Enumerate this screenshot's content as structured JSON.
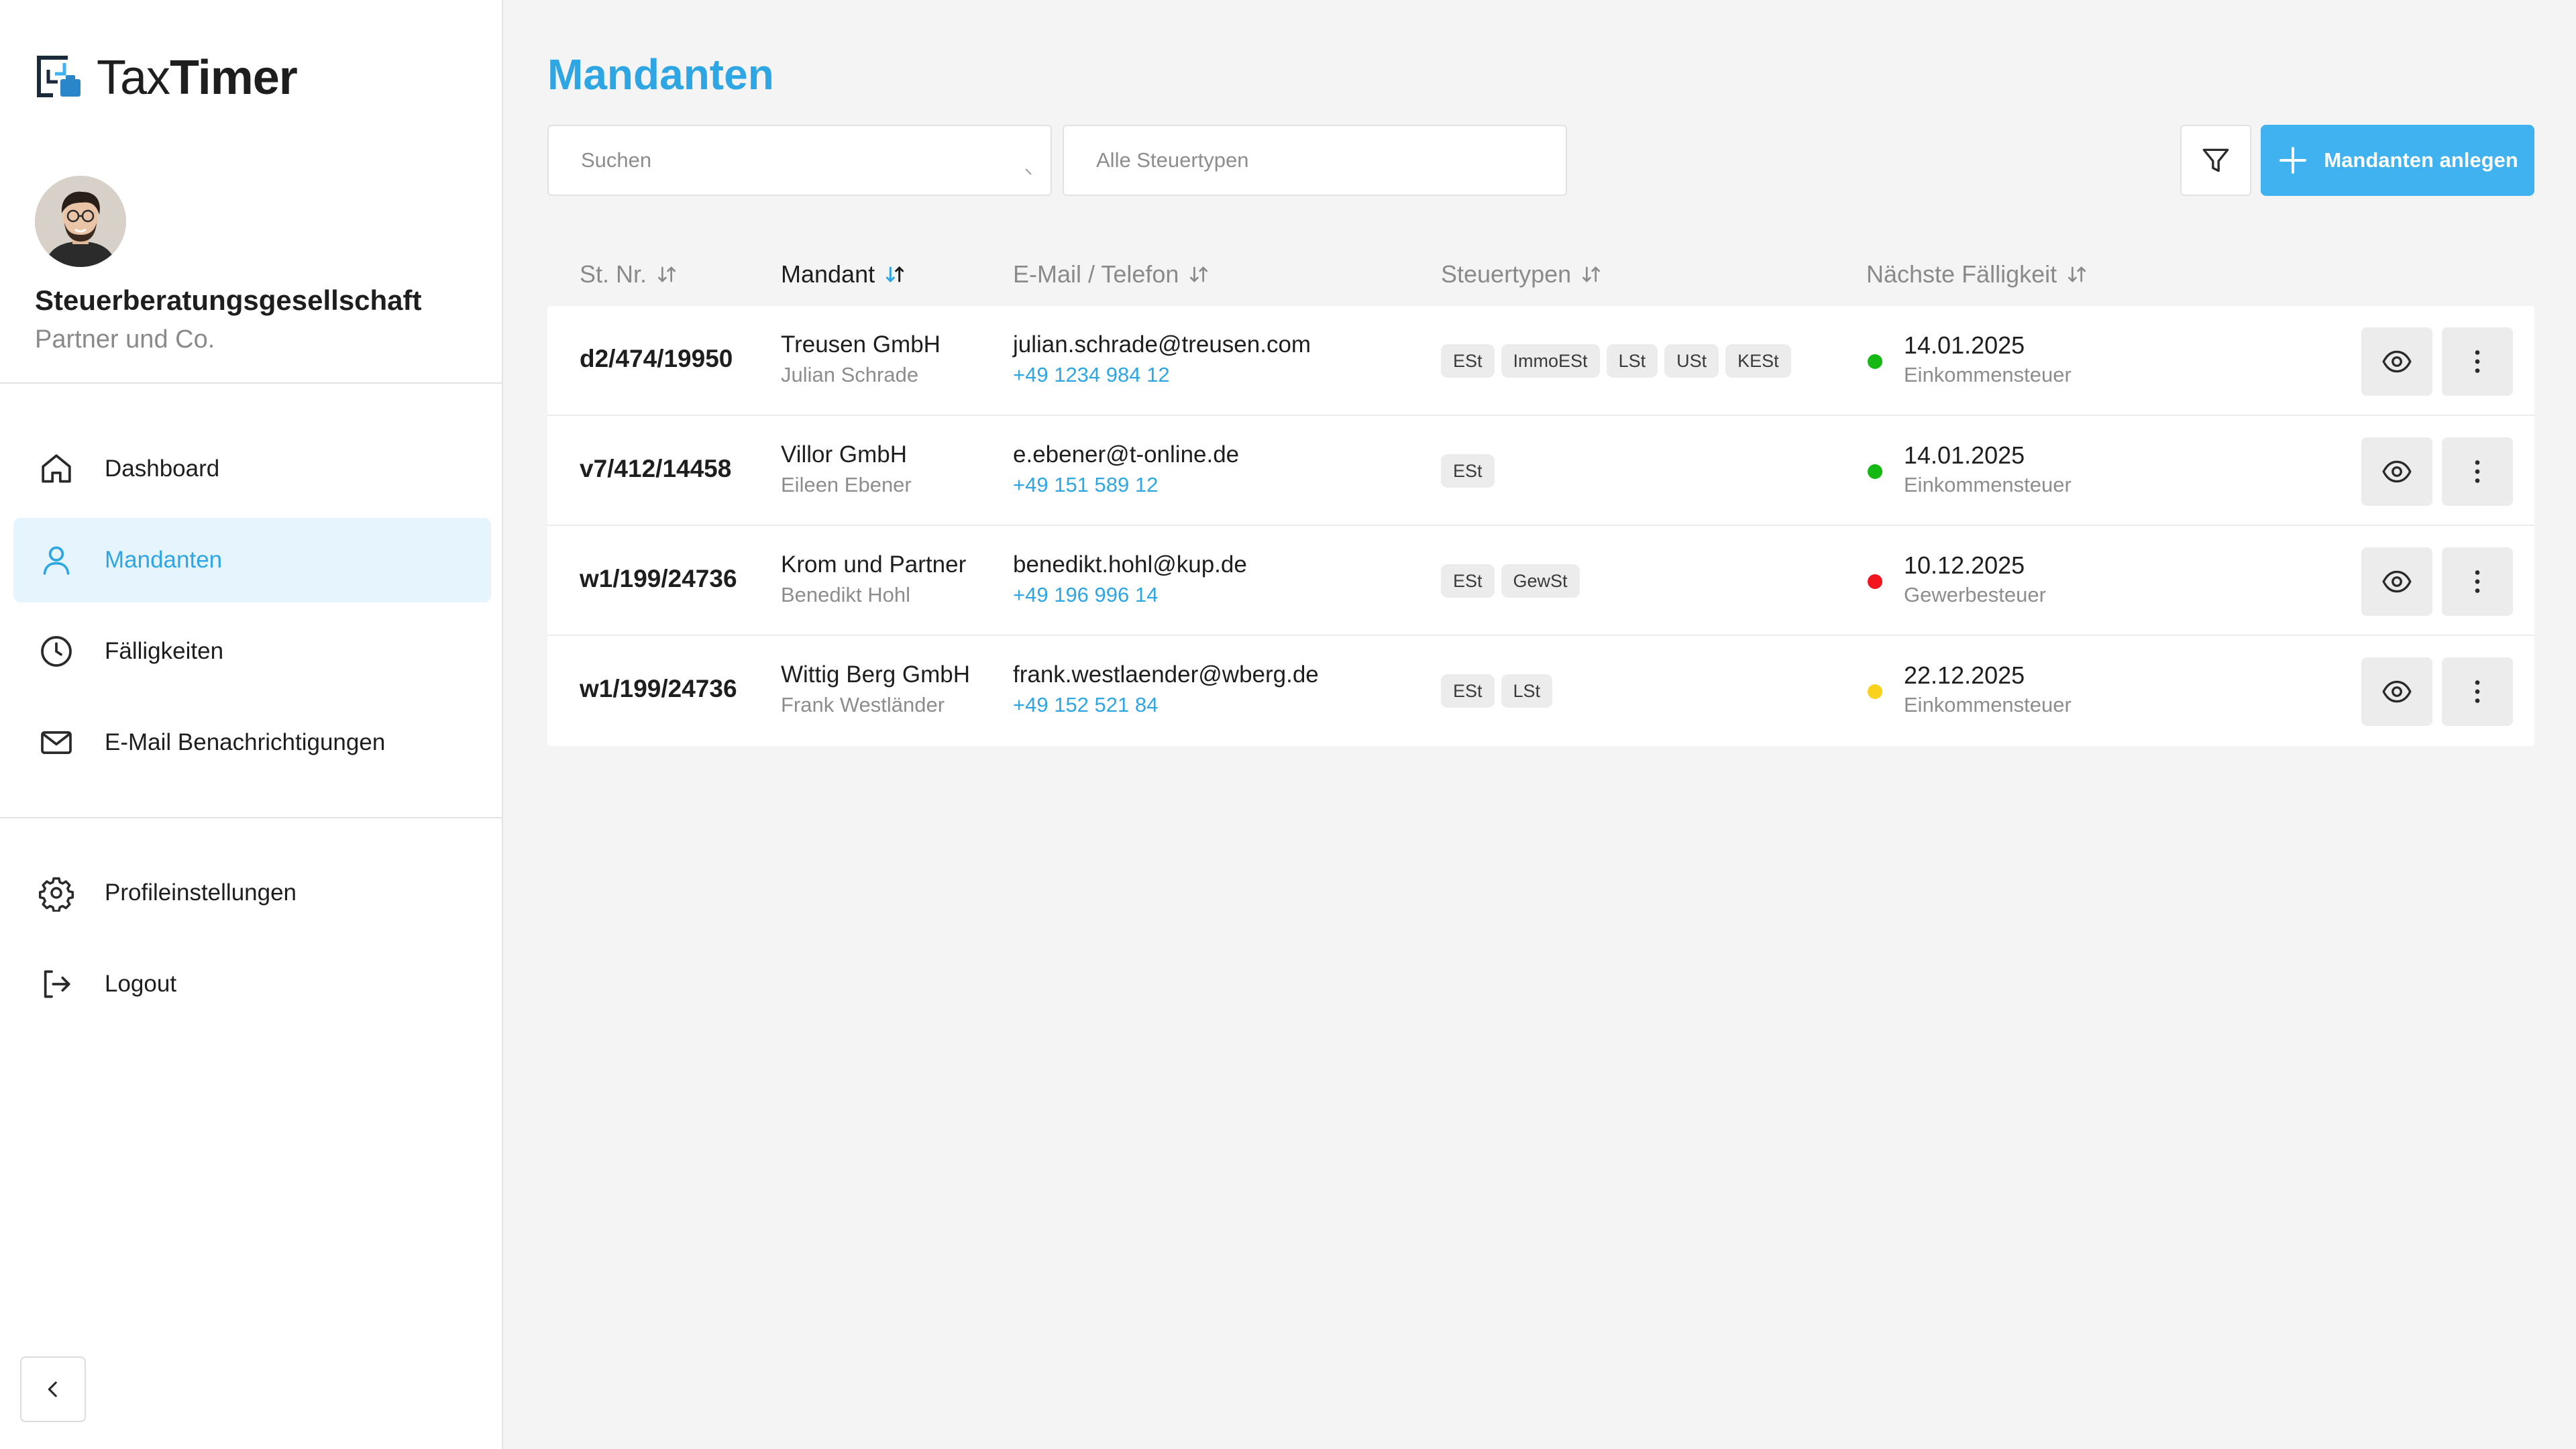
{
  "brand": {
    "logo_prefix": "Tax",
    "logo_suffix": "Timer"
  },
  "profile": {
    "org_name": "Steuerberatungsgesellschaft",
    "org_sub": "Partner und Co."
  },
  "nav": [
    {
      "label": "Dashboard",
      "icon": "home-icon",
      "active": false
    },
    {
      "label": "Mandanten",
      "icon": "user-icon",
      "active": true
    },
    {
      "label": "Fälligkeiten",
      "icon": "clock-icon",
      "active": false
    },
    {
      "label": "E-Mail Benachrichtigungen",
      "icon": "mail-icon",
      "active": false
    }
  ],
  "nav_bottom": [
    {
      "label": "Profileinstellungen",
      "icon": "gear-icon"
    },
    {
      "label": "Logout",
      "icon": "logout-icon"
    }
  ],
  "page": {
    "title": "Mandanten",
    "search_placeholder": "Suchen",
    "type_filter_placeholder": "Alle Steuertypen",
    "add_button": "Mandanten anlegen"
  },
  "table": {
    "columns": [
      "St. Nr.",
      "Mandant",
      "E-Mail / Telefon",
      "Steuertypen",
      "Nächste Fälligkeit"
    ],
    "sorted_column": "Mandant",
    "rows": [
      {
        "st_nr": "d2/474/19950",
        "name": "Treusen GmbH",
        "person": "Julian Schrade",
        "email": "julian.schrade@treusen.com",
        "phone": "+49 1234 984 12",
        "tags": [
          "ESt",
          "ImmoESt",
          "LSt",
          "USt",
          "KESt"
        ],
        "status": "green",
        "due_date": "14.01.2025",
        "due_type": "Einkommensteuer"
      },
      {
        "st_nr": "v7/412/14458",
        "name": "Villor GmbH",
        "person": "Eileen Ebener",
        "email": "e.ebener@t-online.de",
        "phone": "+49 151 589 12",
        "tags": [
          "ESt"
        ],
        "status": "green",
        "due_date": "14.01.2025",
        "due_type": "Einkommensteuer"
      },
      {
        "st_nr": "w1/199/24736",
        "name": "Krom und Partner",
        "person": "Benedikt Hohl",
        "email": "benedikt.hohl@kup.de",
        "phone": "+49 196 996 14",
        "tags": [
          "ESt",
          "GewSt"
        ],
        "status": "red",
        "due_date": "10.12.2025",
        "due_type": "Gewerbesteuer"
      },
      {
        "st_nr": "w1/199/24736",
        "name": "Wittig Berg GmbH",
        "person": "Frank Westländer",
        "email": "frank.westlaender@wberg.de",
        "phone": "+49 152 521 84",
        "tags": [
          "ESt",
          "LSt"
        ],
        "status": "yellow",
        "due_date": "22.12.2025",
        "due_type": "Einkommensteuer"
      }
    ]
  },
  "colors": {
    "accent": "#3fb2ef",
    "accent_text": "#2ea6e4",
    "active_nav_bg": "#e6f5fd",
    "status_green": "#16b814",
    "status_red": "#f2141f",
    "status_yellow": "#f8d21c"
  }
}
